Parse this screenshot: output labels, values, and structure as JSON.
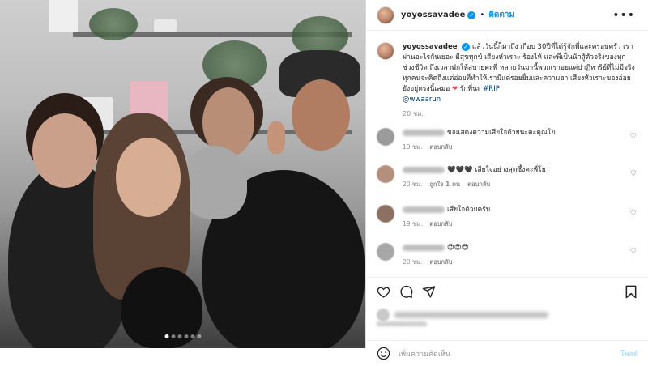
{
  "post": {
    "username": "yoyossavadee",
    "separator": "•",
    "follow_label": "ติดตาม",
    "more_label": "•••",
    "caption": {
      "text_before": "แล้ววันนี้ก็มาถึง เกือบ 30ปีที่ได้รู้จักพี่และครอบครัว เราผ่านอะไรกันเยอะ มีสุขทุกข์ เสียงหัวเราะ ร้องไห้ และพี่เป็นนักสู้ตัวจริงของทุกช่วงชีวิต ถึงเวลาพักให้สบายคะพี่ หลายวันมานี้พวกเราอยแค่ปาฏิหาริย์ที่ไม่มีจริง ทุกคนจะคิดถึงแต่อ่อยที่ทำให้เรามีแต่รอยยิ้มและความฮา เสียงหัวเราะของอ่อยยังอยู่ครงนี้เสมอ",
      "text_after": "รักพี่นะ",
      "hashtag": "#RIP",
      "mention": "@wwaarun",
      "time": "20 ชม."
    },
    "carousel": {
      "count": 6,
      "active": 0
    },
    "icon_colors": {
      "verified": "#0095f6",
      "heart": "#ed4956",
      "follow": "#0095f6"
    }
  },
  "comments": [
    {
      "text": "ขอแสดงความเสียใจด้วยนะคะคุณโย",
      "time": "19 ชม.",
      "reply": "ตอบกลับ",
      "likes": ""
    },
    {
      "text": "🖤🖤🖤 เสียใจอย่างสุดซึ้งคะพี่โย",
      "time": "20 ชม.",
      "likes": "ถูกใจ 1 คน",
      "reply": "ตอบกลับ"
    },
    {
      "text": "เสียใจด้วยครับ",
      "time": "19 ชม.",
      "reply": "ตอบกลับ",
      "likes": ""
    },
    {
      "text": "😍😍😍",
      "time": "20 ชม.",
      "reply": "ตอบกลับ",
      "likes": ""
    }
  ],
  "add_comment": {
    "placeholder": "เพิ่มความคิดเห็น",
    "post_label": "โพสต์"
  }
}
